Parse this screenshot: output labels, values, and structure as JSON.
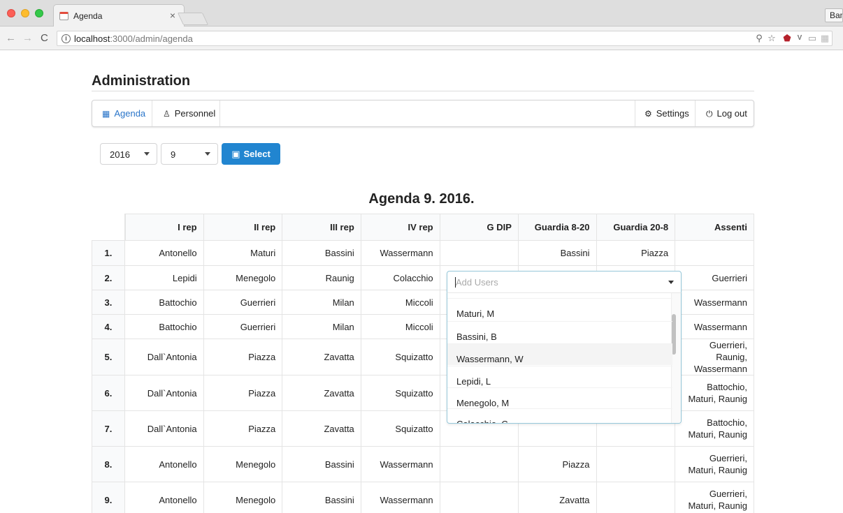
{
  "browser": {
    "tab_title": "Agenda",
    "tab_close": "×",
    "profile_label": "Bam",
    "url_host": "localhost",
    "url_path": ":3000/admin/agenda"
  },
  "page": {
    "title": "Administration",
    "menu": {
      "agenda": "Agenda",
      "personnel": "Personnel",
      "settings": "Settings",
      "logout": "Log out"
    },
    "filters": {
      "year": "2016",
      "month": "9",
      "select_button": "Select"
    },
    "agenda_title": "Agenda 9. 2016."
  },
  "table": {
    "columns": [
      "I rep",
      "II rep",
      "III rep",
      "IV rep",
      "G DIP",
      "Guardia 8-20",
      "Guardia 20-8",
      "Assenti"
    ],
    "rows": [
      {
        "num": "1.",
        "i": "Antonello",
        "ii": "Maturi",
        "iii": "Bassini",
        "iv": "Wassermann",
        "gdip": "",
        "g820": "Bassini",
        "g208": "Piazza",
        "assenti": ""
      },
      {
        "num": "2.",
        "i": "Lepidi",
        "ii": "Menegolo",
        "iii": "Raunig",
        "iv": "Colacchio",
        "gdip": "",
        "g820": "",
        "g208": "",
        "assenti": "Guerrieri"
      },
      {
        "num": "3.",
        "i": "Battochio",
        "ii": "Guerrieri",
        "iii": "Milan",
        "iv": "Miccoli",
        "gdip": "",
        "g820": "",
        "g208": "",
        "assenti": "Wassermann"
      },
      {
        "num": "4.",
        "i": "Battochio",
        "ii": "Guerrieri",
        "iii": "Milan",
        "iv": "Miccoli",
        "gdip": "",
        "g820": "",
        "g208": "",
        "assenti": "Wassermann"
      },
      {
        "num": "5.",
        "i": "Dall`Antonia",
        "ii": "Piazza",
        "iii": "Zavatta",
        "iv": "Squizatto",
        "gdip": "",
        "g820": "",
        "g208": "",
        "assenti": "Guerrieri, Raunig, Wassermann"
      },
      {
        "num": "6.",
        "i": "Dall`Antonia",
        "ii": "Piazza",
        "iii": "Zavatta",
        "iv": "Squizatto",
        "gdip": "",
        "g820": "",
        "g208": "",
        "assenti": "Battochio, Maturi, Raunig"
      },
      {
        "num": "7.",
        "i": "Dall`Antonia",
        "ii": "Piazza",
        "iii": "Zavatta",
        "iv": "Squizatto",
        "gdip": "",
        "g820": "",
        "g208": "",
        "assenti": "Battochio, Maturi, Raunig"
      },
      {
        "num": "8.",
        "i": "Antonello",
        "ii": "Menegolo",
        "iii": "Bassini",
        "iv": "Wassermann",
        "gdip": "",
        "g820": "Piazza",
        "g208": "",
        "assenti": "Guerrieri, Maturi, Raunig"
      },
      {
        "num": "9.",
        "i": "Antonello",
        "ii": "Menegolo",
        "iii": "Bassini",
        "iv": "Wassermann",
        "gdip": "",
        "g820": "Zavatta",
        "g208": "",
        "assenti": "Guerrieri, Maturi, Raunig"
      }
    ]
  },
  "dropdown": {
    "placeholder": "Add Users",
    "options": [
      "Maturi, M",
      "Bassini, B",
      "Wassermann, W",
      "Lepidi, L",
      "Menegolo, M",
      "Colacchio, C"
    ],
    "hovered_option": "Wassermann, W"
  }
}
